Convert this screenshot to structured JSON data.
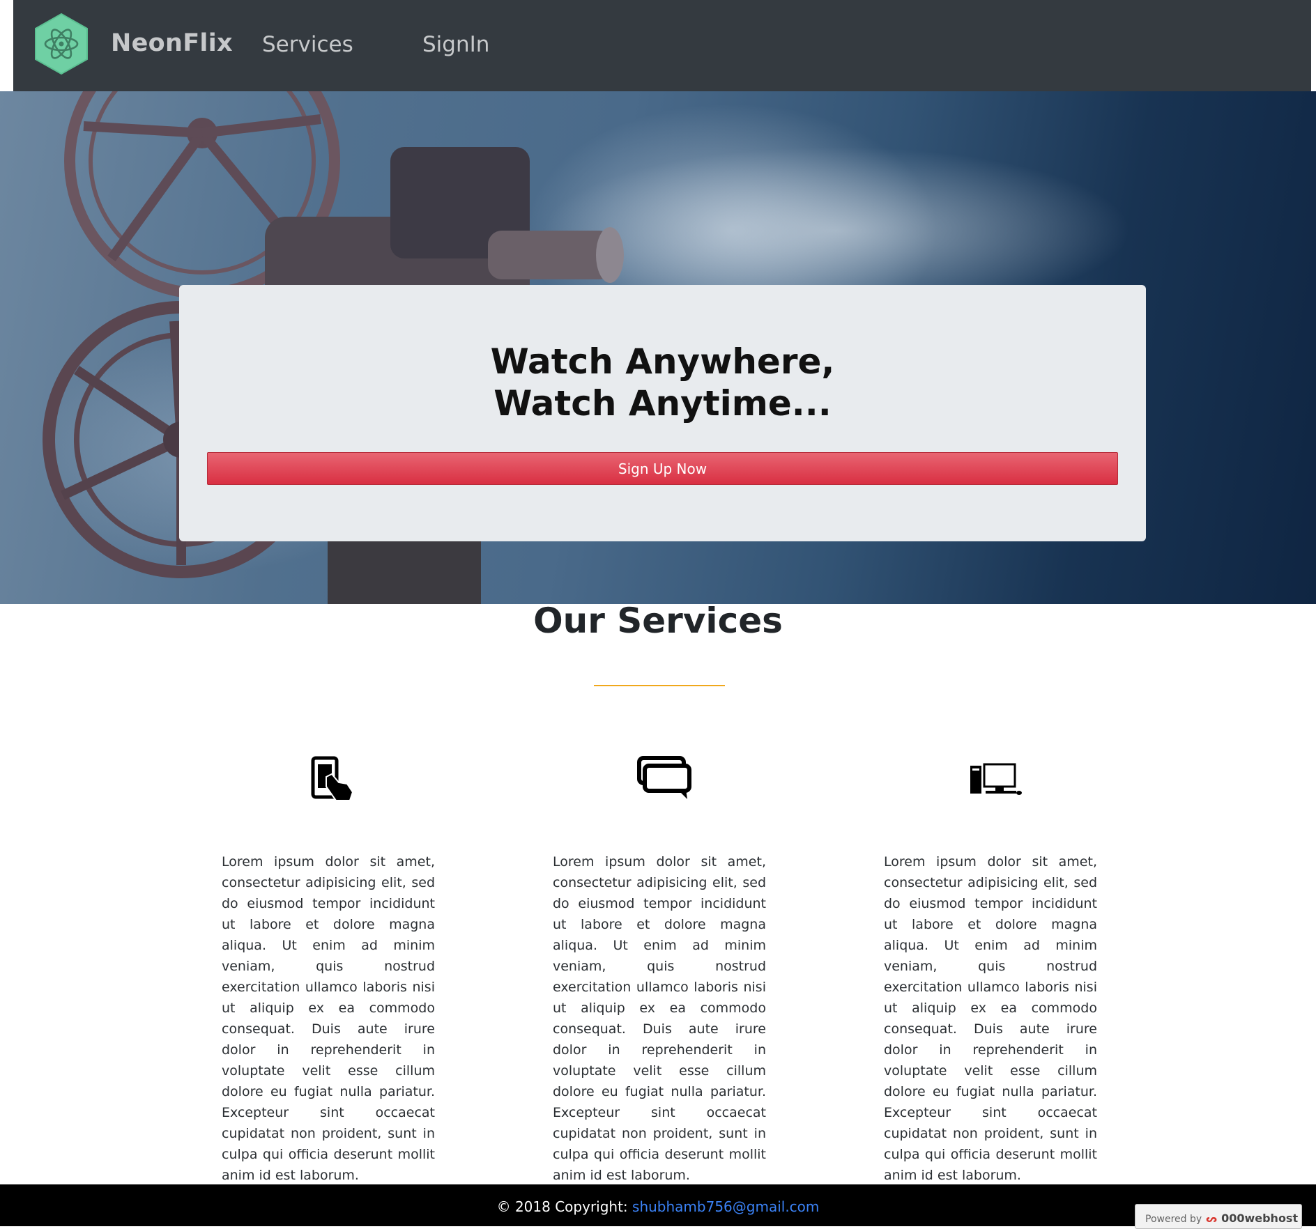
{
  "navbar": {
    "brand": "NeonFlix",
    "links": [
      "Services",
      "SignIn"
    ]
  },
  "hero": {
    "title_line1": "Watch Anywhere,",
    "title_line2": "Watch Anytime...",
    "button_label": "Sign Up Now"
  },
  "services": {
    "title": "Our Services",
    "items": [
      {
        "icon": "touch-phone-icon",
        "text": "Lorem ipsum dolor sit amet, consectetur adipisicing elit, sed do eiusmod tempor incididunt ut labore et dolore magna aliqua. Ut enim ad minim veniam, quis nostrud exercitation ullamco laboris nisi ut aliquip ex ea commodo consequat. Duis aute irure dolor in reprehenderit in voluptate velit esse cillum dolore eu fugiat nulla pariatur. Excepteur sint occaecat cupidatat non proident, sunt in culpa qui officia deserunt mollit anim id est laborum."
      },
      {
        "icon": "chat-bubbles-icon",
        "text": "Lorem ipsum dolor sit amet, consectetur adipisicing elit, sed do eiusmod tempor incididunt ut labore et dolore magna aliqua. Ut enim ad minim veniam, quis nostrud exercitation ullamco laboris nisi ut aliquip ex ea commodo consequat. Duis aute irure dolor in reprehenderit in voluptate velit esse cillum dolore eu fugiat nulla pariatur. Excepteur sint occaecat cupidatat non proident, sunt in culpa qui officia deserunt mollit anim id est laborum."
      },
      {
        "icon": "desktop-computer-icon",
        "text": "Lorem ipsum dolor sit amet, consectetur adipisicing elit, sed do eiusmod tempor incididunt ut labore et dolore magna aliqua. Ut enim ad minim veniam, quis nostrud exercitation ullamco laboris nisi ut aliquip ex ea commodo consequat. Duis aute irure dolor in reprehenderit in voluptate velit esse cillum dolore eu fugiat nulla pariatur. Excepteur sint occaecat cupidatat non proident, sunt in culpa qui officia deserunt mollit anim id est laborum."
      }
    ]
  },
  "footer": {
    "copyright": "© 2018 Copyright: ",
    "email": "shubhamb756@gmail.com",
    "powered_by": "Powered by",
    "host": "000webhost"
  },
  "colors": {
    "navbar": "#343a40",
    "logo": "#6fd0a4",
    "button": "#dc3545",
    "divider": "#f0a81c",
    "footer": "#000000",
    "link": "#3b82f6"
  }
}
